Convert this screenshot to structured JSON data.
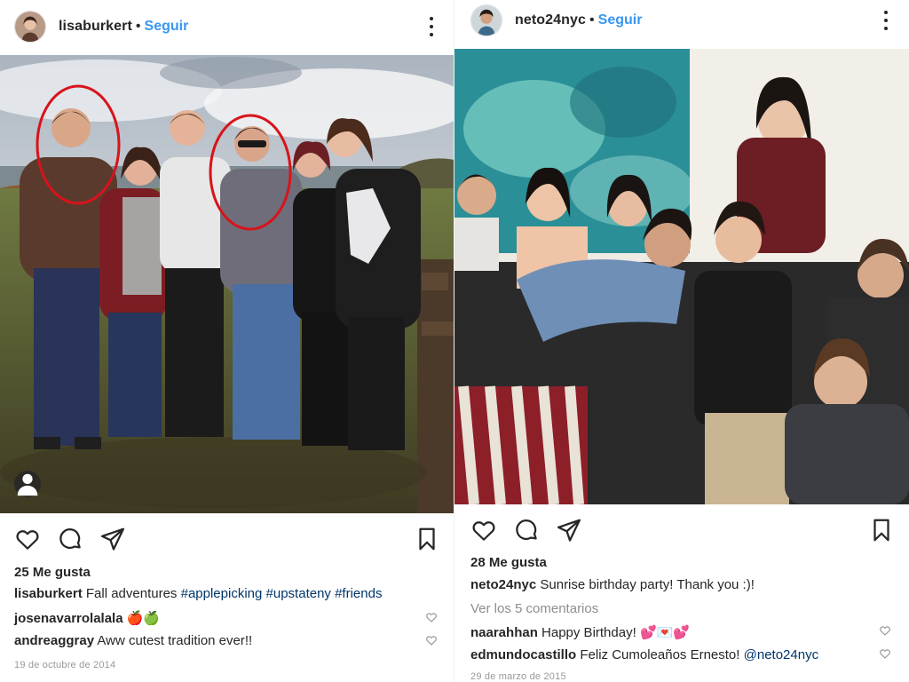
{
  "posts": [
    {
      "username": "lisaburkert",
      "follow_label": "Seguir",
      "separator": "•",
      "icons": {
        "like": "heart-icon",
        "comment": "comment-icon",
        "share": "send-icon",
        "save": "bookmark-icon",
        "more": "more-options-icon",
        "tag": "user-tag-icon"
      },
      "likes": "25 Me gusta",
      "caption": {
        "username": "lisaburkert",
        "text": "Fall adventures",
        "hashtags": [
          "#applepicking",
          "#upstateny",
          "#friends"
        ]
      },
      "comments": [
        {
          "username": "josenavarrolalala",
          "text": "🍎🍏"
        },
        {
          "username": "andreaggray",
          "text": "Aww cutest tradition ever!!"
        }
      ],
      "date": "19 de octubre de 2014"
    },
    {
      "username": "neto24nyc",
      "follow_label": "Seguir",
      "separator": "•",
      "likes": "28 Me gusta",
      "caption": {
        "username": "neto24nyc",
        "text": "Sunrise birthday party! Thank you :)!"
      },
      "view_comments": "Ver los 5 comentarios",
      "comments": [
        {
          "username": "naarahhan",
          "text": "Happy Birthday!",
          "emoji": "💕💌💕"
        },
        {
          "username": "edmundocastillo",
          "text": "Feliz Cumoleaños Ernesto!",
          "mention": "@neto24nyc"
        }
      ],
      "date": "29 de marzo de 2015"
    }
  ],
  "colors": {
    "link_blue": "#3897f0",
    "hashtag": "#003569",
    "text": "#262626",
    "muted": "#8e8e8e"
  }
}
